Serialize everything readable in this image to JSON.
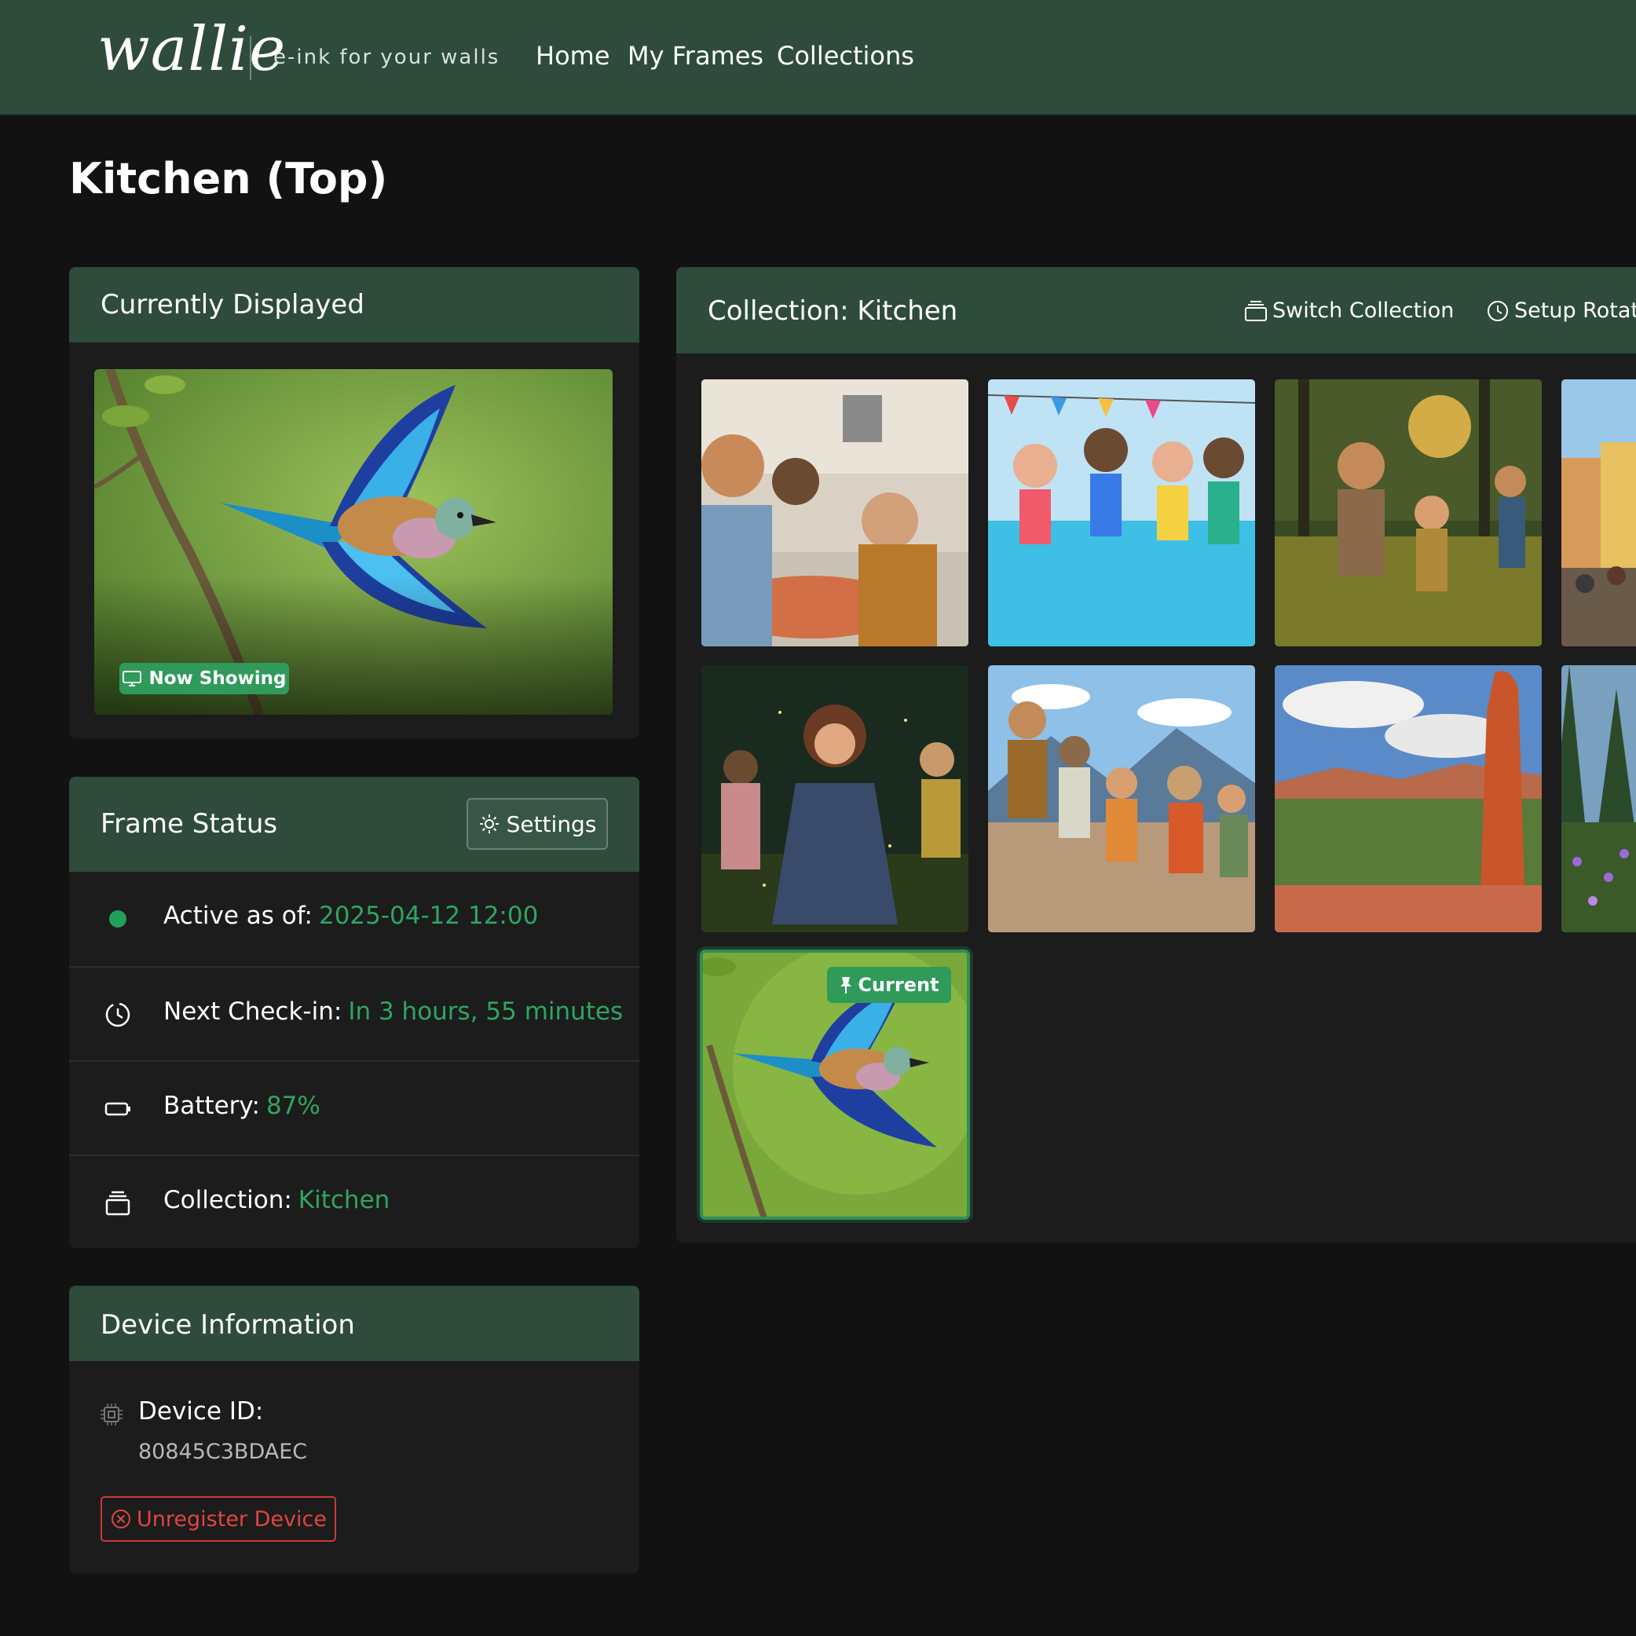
{
  "brand": {
    "logo": "wallie",
    "tagline": "e-ink for your walls"
  },
  "nav": {
    "home": "Home",
    "my_frames": "My Frames",
    "collections": "Collections"
  },
  "page": {
    "title": "Kitchen (Top)"
  },
  "displayed": {
    "title": "Currently Displayed",
    "badge": "Now Showing",
    "image_icon": "bird-photo"
  },
  "status": {
    "title": "Frame Status",
    "settings_label": "Settings",
    "active_label": "Active as of:",
    "active_value": "2025-04-12 12:00",
    "checkin_label": "Next Check-in:",
    "checkin_value": "In 3 hours, 55 minutes",
    "battery_label": "Battery:",
    "battery_value": "87%",
    "collection_label": "Collection:",
    "collection_value": "Kitchen",
    "status_dot_color": "#22a05b"
  },
  "device": {
    "title": "Device Information",
    "id_label": "Device ID:",
    "id_value": "80845C3BDAEC",
    "unregister_label": "Unregister Device"
  },
  "collection": {
    "title": "Collection: Kitchen",
    "switch_label": "Switch Collection",
    "rotation_label": "Setup Rotation",
    "current_badge": "Current",
    "thumbnails": [
      "kitchen-kids-pasta",
      "kids-pool-jump",
      "kids-forest-sunset",
      "street-market",
      "girl-fireflies-night",
      "family-mountain-hike",
      "red-rock-canyon",
      "forest-wildflowers",
      "bird-flight"
    ]
  },
  "colors": {
    "header_green": "#2e4b3b",
    "accent_green": "#2fa562",
    "danger_red": "#e04444",
    "page_bg": "#121212",
    "card_bg": "#1c1c1c"
  }
}
